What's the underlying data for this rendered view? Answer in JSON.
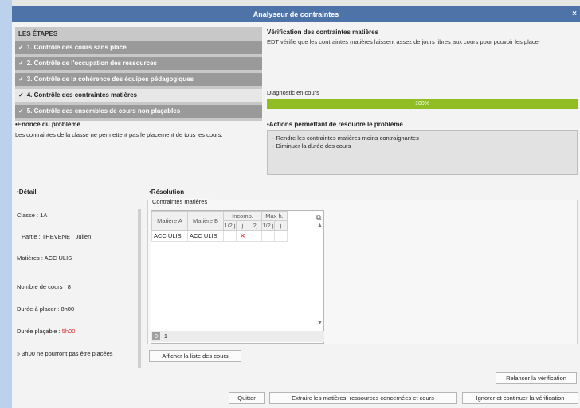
{
  "window": {
    "title": "Analyseur de contraintes",
    "close_glyph": "×"
  },
  "steps": {
    "header": "LES ÉTAPES",
    "items": [
      {
        "label": "1. Contrôle des cours sans place"
      },
      {
        "label": "2. Contrôle de l'occupation des ressources"
      },
      {
        "label": "3. Contrôle de la cohérence des équipes pédagogiques"
      },
      {
        "label": "4. Contrôle des contraintes matières"
      },
      {
        "label": "5. Contrôle des ensembles de cours non plaçables"
      }
    ]
  },
  "verification": {
    "title": "Vérification des contraintes matières",
    "text": "EDT vérifie que les contraintes matières laissent assez de jours libres aux cours pour pouvoir les placer"
  },
  "diagnostic": {
    "label": "Diagnostic en cours",
    "progress_text": "100%",
    "progress_value": 100
  },
  "problem": {
    "title": "•Enoncé du problème",
    "text": "Les contraintes de la classe ne permettent pas le placement de tous les cours."
  },
  "actions": {
    "title": "•Actions permettant de résoudre le problème",
    "items": [
      "- Rendre les contraintes matières moins contraignantes",
      "- Diminuer la durée des cours"
    ]
  },
  "detail": {
    "title": "•Détail",
    "classe": "Classe : 1A",
    "partie": "Partie : THEVENET Julien",
    "matieres": "Matières : ACC ULIS",
    "nb_cours": "Nombre de cours : 8",
    "duree_placer": "Durée à placer : 8h00",
    "duree_placable_label": "Durée plaçable : ",
    "duree_placable_value": "5h00",
    "warning": "» 3h00 ne pourront pas être placées"
  },
  "resolution": {
    "title": "•Résolution",
    "subtitle": "Contraintes matières",
    "headers": {
      "matiere_a": "Matière A",
      "matiere_b": "Matière B",
      "incomp": "Incomp.",
      "maxh": "Max h.",
      "half1": "1/2 j",
      "j1": "j",
      "twoj": "2j",
      "half2": "1/2 j",
      "j2": "j"
    },
    "row": {
      "a": "ACC ULIS",
      "b": "ACC ULIS",
      "mark": "✕"
    },
    "pages": [
      "0",
      "1"
    ],
    "show_courses_button": "Afficher la liste des cours"
  },
  "buttons": {
    "relaunch": "Relancer la vérification",
    "quit": "Quitter",
    "extract": "Extraire les matières, ressources concernées et cours",
    "ignore": "Ignorer et continuer la vérification"
  }
}
